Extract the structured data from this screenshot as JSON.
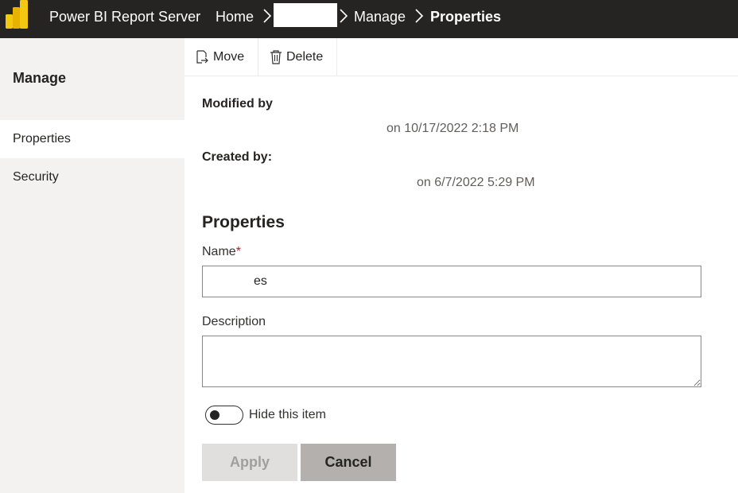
{
  "header": {
    "app_title": "Power BI Report Server",
    "breadcrumbs": [
      "Home",
      "",
      "Manage",
      "Properties"
    ]
  },
  "sidebar": {
    "heading": "Manage",
    "items": [
      {
        "label": "Properties",
        "selected": true
      },
      {
        "label": "Security",
        "selected": false
      }
    ]
  },
  "toolbar": {
    "move_label": "Move",
    "delete_label": "Delete"
  },
  "meta": {
    "modified_label": "Modified by",
    "modified_date": "on 10/17/2022 2:18 PM",
    "created_label": "Created by:",
    "created_date": "on 6/7/2022 5:29 PM"
  },
  "form": {
    "section_title": "Properties",
    "name_label": "Name",
    "name_required_marker": "*",
    "name_value": "es",
    "description_label": "Description",
    "description_value": "",
    "hide_label": "Hide this item",
    "hide_checked": false,
    "apply_label": "Apply",
    "cancel_label": "Cancel"
  },
  "colors": {
    "topbar": "#252423",
    "sidebar": "#f3f2f1",
    "logo_yellow": "#f2c811",
    "required": "#a4262c"
  },
  "icons": {
    "logo": "power-bi-logo",
    "move": "move-icon",
    "delete": "trash-icon",
    "chevron": "chevron-right-icon"
  }
}
